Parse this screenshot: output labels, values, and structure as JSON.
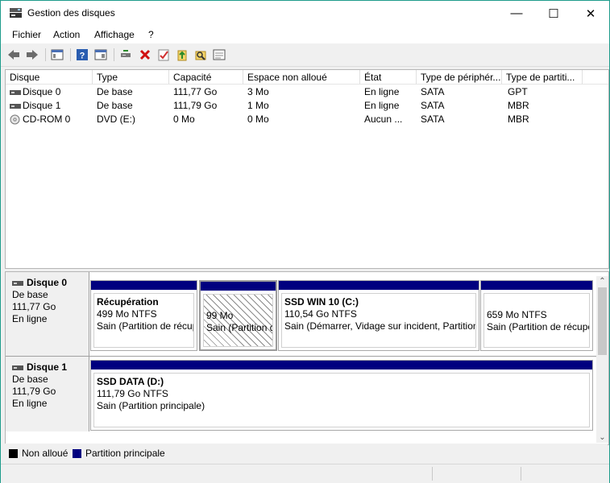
{
  "window": {
    "title": "Gestion des disques",
    "minimize": "—",
    "maximize": "☐",
    "close": "✕"
  },
  "menu": [
    "Fichier",
    "Action",
    "Affichage",
    "?"
  ],
  "toolbar": {
    "help_glyph": "?"
  },
  "columns": [
    "Disque",
    "Type",
    "Capacité",
    "Espace non alloué",
    "État",
    "Type de périphér...",
    "Type de partiti..."
  ],
  "rows": [
    {
      "disk": "Disque 0",
      "type": "De base",
      "capacity": "111,77 Go",
      "unallocated": "3 Mo",
      "state": "En ligne",
      "device": "SATA",
      "partition": "GPT",
      "icon": "hard-disk-icon"
    },
    {
      "disk": "Disque 1",
      "type": "De base",
      "capacity": "111,79 Go",
      "unallocated": "1 Mo",
      "state": "En ligne",
      "device": "SATA",
      "partition": "MBR",
      "icon": "hard-disk-icon"
    },
    {
      "disk": "CD-ROM 0",
      "type": "DVD (E:)",
      "capacity": "0 Mo",
      "unallocated": "0 Mo",
      "state": "Aucun ...",
      "device": "SATA",
      "partition": "MBR",
      "icon": "cdrom-icon"
    }
  ],
  "highlight_color": "#fff200",
  "disks": [
    {
      "name": "Disque 0",
      "type": "De base",
      "size": "111,77 Go",
      "state": "En ligne",
      "partitions": [
        {
          "title": "Récupération",
          "size": "499 Mo NTFS",
          "status": "Sain (Partition de récup"
        },
        {
          "title": "",
          "size": "99 Mo",
          "status": "Sain (Partition d"
        },
        {
          "title": "SSD WIN 10  (C:)",
          "size": "110,54 Go NTFS",
          "status": "Sain (Démarrer, Vidage sur incident, Partition"
        },
        {
          "title": "",
          "size": "659 Mo NTFS",
          "status": "Sain (Partition de récupe"
        }
      ]
    },
    {
      "name": "Disque 1",
      "type": "De base",
      "size": "111,79 Go",
      "state": "En ligne",
      "partitions": [
        {
          "title": "SSD DATA  (D:)",
          "size": "111,79 Go NTFS",
          "status": "Sain (Partition principale)"
        }
      ]
    }
  ],
  "legend": [
    {
      "label": "Non alloué",
      "color": "#000000"
    },
    {
      "label": "Partition principale",
      "color": "#00007f"
    }
  ],
  "scroll": {
    "up": "⌃",
    "down": "⌄"
  }
}
